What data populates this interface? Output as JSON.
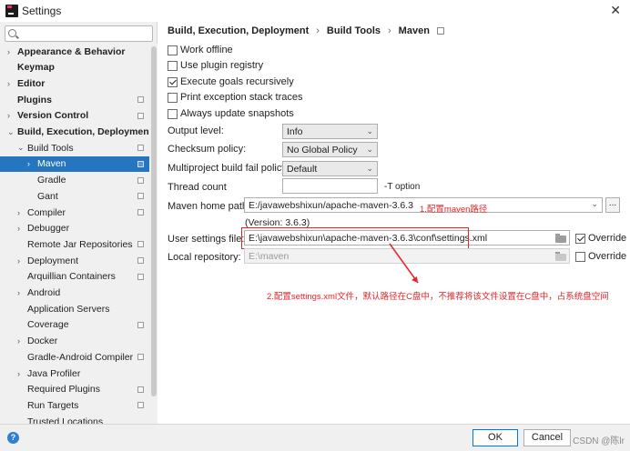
{
  "window": {
    "title": "Settings",
    "close_glyph": "✕"
  },
  "search": {
    "placeholder": "",
    "value": ""
  },
  "sidebar": {
    "items": [
      {
        "label": "Appearance & Behavior",
        "arrow": "›",
        "bold": true,
        "config": false,
        "depth": 0,
        "selected": false
      },
      {
        "label": "Keymap",
        "arrow": "",
        "bold": true,
        "config": false,
        "depth": 0,
        "selected": false
      },
      {
        "label": "Editor",
        "arrow": "›",
        "bold": true,
        "config": false,
        "depth": 0,
        "selected": false
      },
      {
        "label": "Plugins",
        "arrow": "",
        "bold": true,
        "config": true,
        "depth": 0,
        "selected": false
      },
      {
        "label": "Version Control",
        "arrow": "›",
        "bold": true,
        "config": true,
        "depth": 0,
        "selected": false
      },
      {
        "label": "Build, Execution, Deployment",
        "arrow": "⌄",
        "bold": true,
        "config": false,
        "depth": 0,
        "selected": false
      },
      {
        "label": "Build Tools",
        "arrow": "⌄",
        "bold": false,
        "config": true,
        "depth": 1,
        "selected": false
      },
      {
        "label": "Maven",
        "arrow": "›",
        "bold": false,
        "config": true,
        "depth": 2,
        "selected": true
      },
      {
        "label": "Gradle",
        "arrow": "",
        "bold": false,
        "config": true,
        "depth": 2,
        "selected": false
      },
      {
        "label": "Gant",
        "arrow": "",
        "bold": false,
        "config": true,
        "depth": 2,
        "selected": false
      },
      {
        "label": "Compiler",
        "arrow": "›",
        "bold": false,
        "config": true,
        "depth": 1,
        "selected": false
      },
      {
        "label": "Debugger",
        "arrow": "›",
        "bold": false,
        "config": false,
        "depth": 1,
        "selected": false
      },
      {
        "label": "Remote Jar Repositories",
        "arrow": "",
        "bold": false,
        "config": true,
        "depth": 1,
        "selected": false
      },
      {
        "label": "Deployment",
        "arrow": "›",
        "bold": false,
        "config": true,
        "depth": 1,
        "selected": false
      },
      {
        "label": "Arquillian Containers",
        "arrow": "",
        "bold": false,
        "config": true,
        "depth": 1,
        "selected": false
      },
      {
        "label": "Android",
        "arrow": "›",
        "bold": false,
        "config": false,
        "depth": 1,
        "selected": false
      },
      {
        "label": "Application Servers",
        "arrow": "",
        "bold": false,
        "config": false,
        "depth": 1,
        "selected": false
      },
      {
        "label": "Coverage",
        "arrow": "",
        "bold": false,
        "config": true,
        "depth": 1,
        "selected": false
      },
      {
        "label": "Docker",
        "arrow": "›",
        "bold": false,
        "config": false,
        "depth": 1,
        "selected": false
      },
      {
        "label": "Gradle-Android Compiler",
        "arrow": "",
        "bold": false,
        "config": true,
        "depth": 1,
        "selected": false
      },
      {
        "label": "Java Profiler",
        "arrow": "›",
        "bold": false,
        "config": false,
        "depth": 1,
        "selected": false
      },
      {
        "label": "Required Plugins",
        "arrow": "",
        "bold": false,
        "config": true,
        "depth": 1,
        "selected": false
      },
      {
        "label": "Run Targets",
        "arrow": "",
        "bold": false,
        "config": true,
        "depth": 1,
        "selected": false
      },
      {
        "label": "Trusted Locations",
        "arrow": "",
        "bold": false,
        "config": false,
        "depth": 1,
        "selected": false
      }
    ]
  },
  "breadcrumb": {
    "items": [
      "Build, Execution, Deployment",
      "Build Tools",
      "Maven"
    ],
    "separator": "›"
  },
  "checkboxes": [
    {
      "label": "Work offline",
      "checked": false
    },
    {
      "label": "Use plugin registry",
      "checked": false
    },
    {
      "label": "Execute goals recursively",
      "checked": true
    },
    {
      "label": "Print exception stack traces",
      "checked": false
    },
    {
      "label": "Always update snapshots",
      "checked": false
    }
  ],
  "fields": {
    "output_level": {
      "label": "Output level:",
      "value": "Info"
    },
    "checksum_policy": {
      "label": "Checksum policy:",
      "value": "No Global Policy"
    },
    "multiproject_fail_policy": {
      "label": "Multiproject build fail policy:",
      "value": "Default"
    },
    "thread_count": {
      "label": "Thread count",
      "value": "",
      "hint": "-T option"
    },
    "maven_home": {
      "label": "Maven home path:",
      "value": "E:/javawebshixun/apache-maven-3.6.3",
      "browse": "..."
    },
    "version": "(Version: 3.6.3)",
    "user_settings": {
      "label": "User settings file:",
      "value": "E:\\javawebshixun\\apache-maven-3.6.3\\conf\\settings.xml",
      "override_label": "Override",
      "override_checked": true
    },
    "local_repo": {
      "label": "Local repository:",
      "value": "E:\\maven",
      "override_label": "Override",
      "override_checked": false
    }
  },
  "annotations": {
    "note1": "1.配置maven路径",
    "note2": "2.配置settings.xml文件，默认路径在C盘中，不推荐将该文件设置在C盘中，占系统盘空间",
    "color": "#e5252a"
  },
  "footer": {
    "help": "?",
    "ok": "OK",
    "cancel": "Cancel",
    "watermark": "CSDN @陈lr"
  },
  "colors": {
    "selection": "#2675bf",
    "sidebar_bg": "#f0f0f0"
  }
}
